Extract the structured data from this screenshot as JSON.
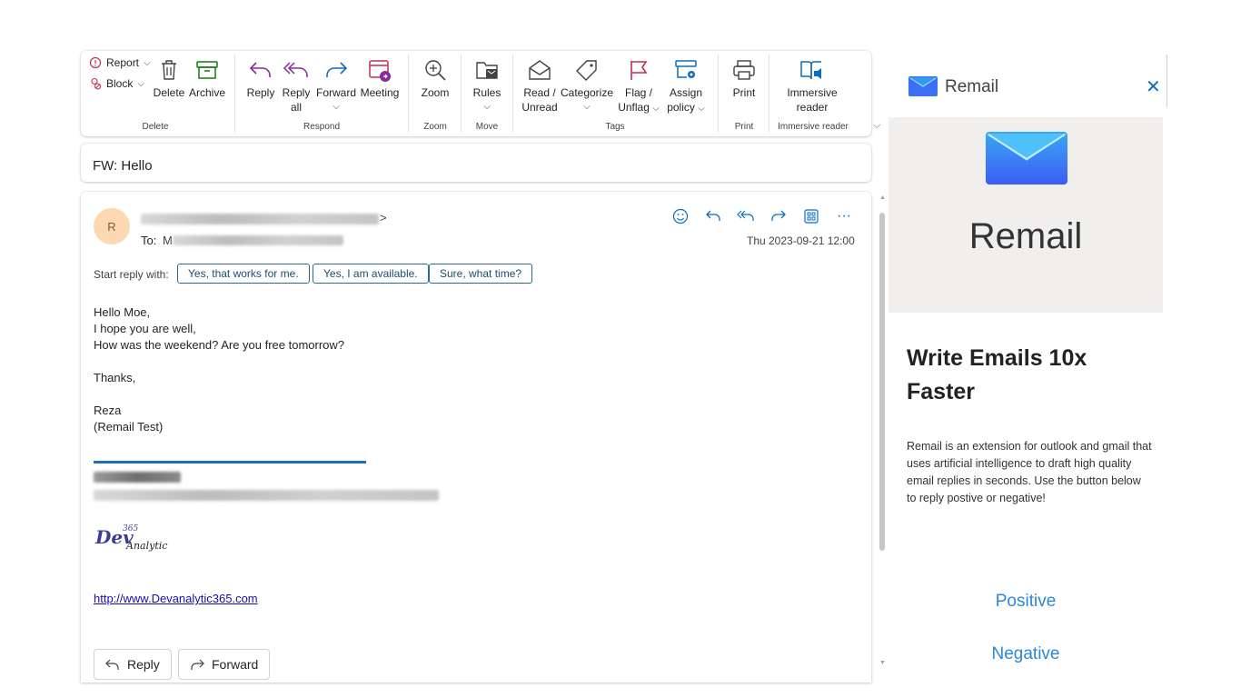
{
  "ribbon": {
    "report": "Report",
    "block": "Block",
    "delete": "Delete",
    "archive": "Archive",
    "reply": "Reply",
    "reply_all_1": "Reply",
    "reply_all_2": "all",
    "forward": "Forward",
    "meeting": "Meeting",
    "zoom": "Zoom",
    "rules": "Rules",
    "read_unread_1": "Read /",
    "read_unread_2": "Unread",
    "categorize": "Categorize",
    "flag_1": "Flag /",
    "flag_2": "Unflag",
    "assign_1": "Assign",
    "assign_2": "policy",
    "print": "Print",
    "immersive_1": "Immersive",
    "immersive_2": "reader",
    "groups": {
      "delete": "Delete",
      "respond": "Respond",
      "zoom": "Zoom",
      "move": "Move",
      "tags": "Tags",
      "print": "Print",
      "immersive": "Immersive reader"
    }
  },
  "subject": "FW: Hello",
  "message": {
    "avatar_initial": "R",
    "sender_suffix": ">",
    "to_label": "To:",
    "to_initial": "M",
    "date": "Thu 2023-09-21 12:00",
    "start_reply_label": "Start reply with:",
    "suggestions": [
      "Yes, that works for me.",
      "Yes, I am available.",
      "Sure, what time?"
    ],
    "body": [
      "Hello Moe,",
      "I hope you are well,",
      "How was the weekend? Are you free tomorrow?",
      "Thanks,",
      "Reza",
      "(Remail Test)"
    ],
    "logo_main": "Dev",
    "logo_sub": "Analytic",
    "logo_num": "365",
    "link": "http://www.Devanalytic365.com",
    "reply_button": "Reply",
    "forward_button": "Forward"
  },
  "pane": {
    "header_title": "Remail",
    "hero_title": "Remail",
    "headline": "Write Emails 10x Faster",
    "description": "Remail is an extension for outlook and gmail that uses artificial intelligence to draft high quality email replies in seconds. Use the button below to reply postive or negative!",
    "positive": "Positive",
    "negative": "Negative"
  },
  "colors": {
    "accent_purple": "#8a2a9b",
    "accent_blue": "#0f6cbd",
    "flag_red": "#c4314b",
    "archive_green": "#107c10",
    "link_blue": "#1a0dab",
    "pane_link": "#2b88d8"
  }
}
